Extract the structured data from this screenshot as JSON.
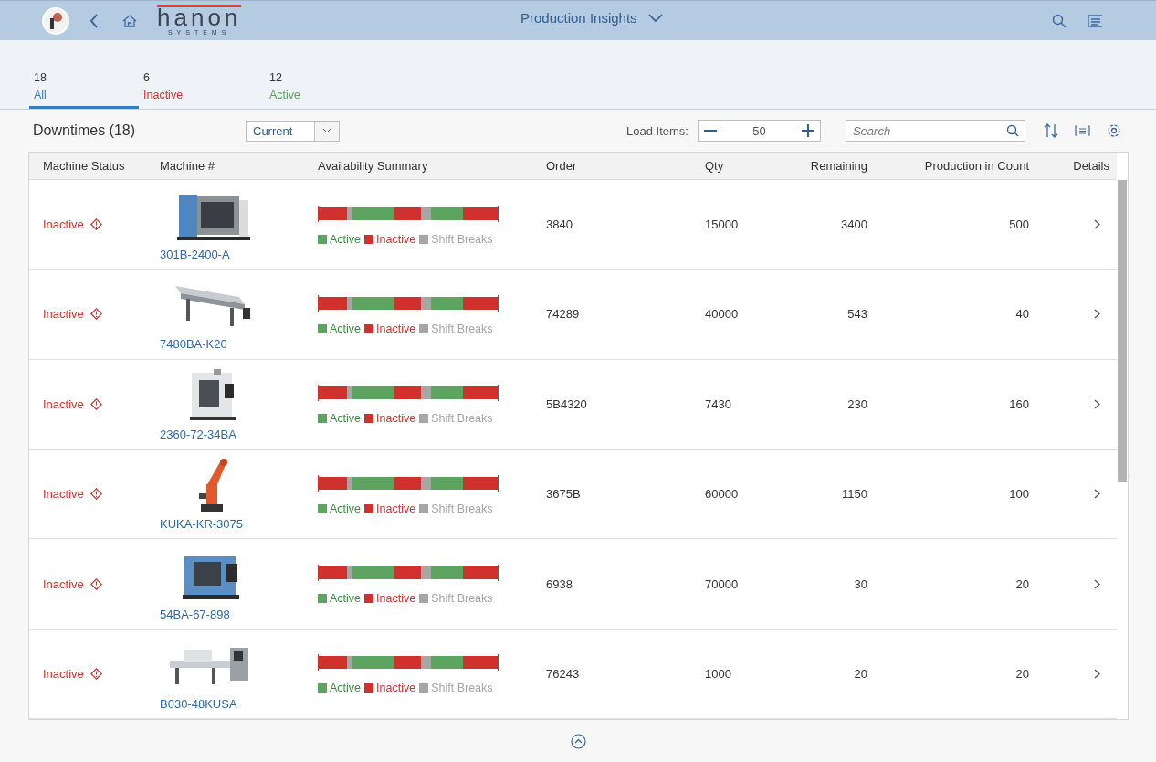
{
  "header": {
    "title": "Production Insights",
    "logo": {
      "name": "hanon",
      "sub": "SYSTEMS"
    }
  },
  "tabs": [
    {
      "count": "18",
      "label": "All",
      "kind": "all",
      "selected": true
    },
    {
      "count": "6",
      "label": "Inactive",
      "kind": "inactive",
      "selected": false
    },
    {
      "count": "12",
      "label": "Active",
      "kind": "active",
      "selected": false
    }
  ],
  "toolbar": {
    "title": "Downtimes (18)",
    "filter": "Current",
    "load_label": "Load Items:",
    "load_value": "50",
    "search": {
      "placeholder": "Search"
    }
  },
  "table": {
    "columns": [
      "Machine Status",
      "Machine #",
      "Availability Summary",
      "Order",
      "Qty",
      "Remaining",
      "Production in Count",
      "Details"
    ],
    "rows": [
      {
        "status": "Inactive",
        "machine": "301B-2400-A",
        "legend": [
          "Active",
          "Inactive",
          "Shift Breaks"
        ],
        "order": "3840",
        "qty": "15000",
        "remaining": "3400",
        "production": "500"
      },
      {
        "status": "Inactive",
        "machine": "7480BA-K20",
        "legend": [
          "Active",
          "Inactive",
          "Shift Breaks"
        ],
        "order": "74289",
        "qty": "40000",
        "remaining": "543",
        "production": "40"
      },
      {
        "status": "Inactive",
        "machine": "2360-72-34BA",
        "legend": [
          "Active",
          "Inactive",
          "Shift Breaks"
        ],
        "order": "5B4320",
        "qty": "7430",
        "remaining": "230",
        "production": "160"
      },
      {
        "status": "Inactive",
        "machine": "KUKA-KR-3075",
        "legend": [
          "Active",
          "Inactive",
          "Shift Breaks"
        ],
        "order": "3675B",
        "qty": "60000",
        "remaining": "1150",
        "production": "100"
      },
      {
        "status": "Inactive",
        "machine": "54BA-67-898",
        "legend": [
          "Active",
          "Inactive",
          "Shift Breaks"
        ],
        "order": "6938",
        "qty": "70000",
        "remaining": "30",
        "production": "20"
      },
      {
        "status": "Inactive",
        "machine": "B030-48KUSA",
        "legend": [
          "Active",
          "Inactive",
          "Shift Breaks"
        ],
        "order": "76243",
        "qty": "1000",
        "remaining": "20",
        "production": "20"
      }
    ]
  }
}
